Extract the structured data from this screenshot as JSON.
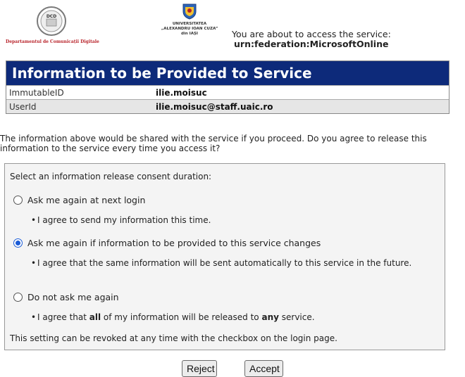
{
  "header": {
    "dcd_logo_text": "Departamentul de Comunicații Digitale",
    "dcd_seal_text": "DCD",
    "uaic_logo_lines": [
      "UNIVERSITATEA",
      "„ALEXANDRU IOAN CUZA”",
      "din IAȘI"
    ],
    "service_prefix": "You are about to access the service:",
    "service_urn": "urn:federation:MicrosoftOnline"
  },
  "info": {
    "title": "Information to be Provided to Service",
    "rows": [
      {
        "key": "ImmutableID",
        "value": "ilie.moisuc"
      },
      {
        "key": "UserId",
        "value": "ilie.moisuc@staff.uaic.ro"
      }
    ]
  },
  "question": "The information above would be shared with the service if you proceed. Do you agree to release this information to the service every time you access it?",
  "consent": {
    "heading": "Select an information release consent duration:",
    "options": [
      {
        "label": "Ask me again at next login",
        "checked": false
      },
      {
        "label": "Ask me again if information to be provided to this service changes",
        "checked": true
      },
      {
        "label": "Do not ask me again",
        "checked": false
      }
    ],
    "bullet1": "I agree to send my information this time.",
    "bullet2": "I agree that the same information will be sent automatically to this service in the future.",
    "bullet3_pre": "I agree that ",
    "bullet3_bold1": "all",
    "bullet3_mid": " of my information will be released to ",
    "bullet3_bold2": "any",
    "bullet3_post": " service.",
    "footer": "This setting can be revoked at any time with the checkbox on the login page."
  },
  "buttons": {
    "reject": "Reject",
    "accept": "Accept"
  },
  "colors": {
    "title_bar": "#0d2a7a",
    "dcd_red": "#b8232a",
    "radio_selected": "#1a5bd6"
  }
}
